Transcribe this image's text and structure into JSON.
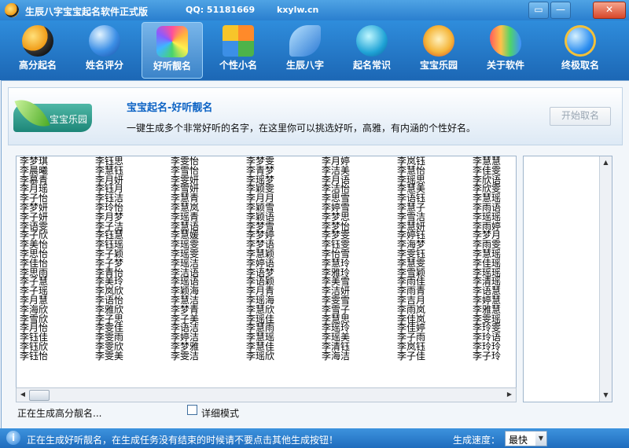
{
  "window": {
    "title": "生辰八字宝宝起名软件正式版",
    "qq": "QQ: 51181669",
    "site": "kxylw.cn",
    "buttons": {
      "menu": "▭",
      "min": "—",
      "close": "✕"
    }
  },
  "toolbar": {
    "items": [
      {
        "label": "高分起名",
        "icon": "yin-yang-icon"
      },
      {
        "label": "姓名评分",
        "icon": "globe-icon"
      },
      {
        "label": "好听靓名",
        "icon": "hexagon-cluster-icon"
      },
      {
        "label": "个性小名",
        "icon": "windows-logo-icon"
      },
      {
        "label": "生辰八字",
        "icon": "bird-icon"
      },
      {
        "label": "起名常识",
        "icon": "internet-icon"
      },
      {
        "label": "宝宝乐园",
        "icon": "mascot-icon"
      },
      {
        "label": "关于软件",
        "icon": "butterfly-icon"
      },
      {
        "label": "终极取名",
        "icon": "ie-globe-icon"
      }
    ],
    "active_index": 2
  },
  "banner": {
    "badge": "宝宝乐园",
    "title": "宝宝起名-好听靓名",
    "description": "一键生成多个非常好听的名字，在这里你可以挑选好听，高雅，有内涵的个性好名。",
    "start_button": "开始取名"
  },
  "names": {
    "columns": [
      [
        "李梦琪",
        "李晨曦",
        "李慕青",
        "李月瑶",
        "李子怡",
        "李梦妍",
        "李子妍",
        "李语雯",
        "李子欣",
        "李美怡",
        "李思怡",
        "李佳怡",
        "李思雨",
        "李子慧",
        "李子瑶",
        "李月慧",
        "李海欣",
        "李雪欣",
        "李月怡",
        "李钰佳",
        "李钰欣",
        "李钰怡"
      ],
      [
        "李钰思",
        "李慧钰",
        "李月妍",
        "李钰月",
        "李钰洁",
        "李玲怡",
        "李月梦",
        "李子洁",
        "李钰慧",
        "李钰瑶",
        "李子颖",
        "李子梦",
        "李青怡",
        "李美玲",
        "李岚欣",
        "李语怡",
        "李雅欣",
        "李子思",
        "李雯佳",
        "李雯雨",
        "李雯欣",
        "李雯美"
      ],
      [
        "李雯怡",
        "李雪怡",
        "李雯妍",
        "李雪妍",
        "李慧青",
        "李慧岚",
        "李瑶青",
        "李慧语",
        "李慧媛",
        "李瑶雯",
        "李瑶雯",
        "李瑶洁",
        "李洁语",
        "李瑶语",
        "李颖海",
        "李慧洁",
        "李梦青",
        "李子美",
        "李语洁",
        "李婷洁",
        "李梦雅",
        "李雯洁"
      ],
      [
        "李梦雯",
        "李青梦",
        "李瑶梦",
        "李颖雯",
        "李月月",
        "李颖雪",
        "李颖语",
        "李梦雪",
        "李梦婷",
        "李梦语",
        "李慧颖",
        "李婷语",
        "李语梦",
        "李语颖",
        "李月青",
        "李瑶海",
        "李慧欣",
        "李瑶佳",
        "李慧雨",
        "李慧瑶",
        "李慧佳",
        "李瑶欣"
      ],
      [
        "李月婷",
        "李洁美",
        "李月语",
        "李洁怡",
        "李思雪",
        "李婷雪",
        "李梦思",
        "李梦怡",
        "李梦雯",
        "李钰雯",
        "李怡雪",
        "李慧玲",
        "李雅玲",
        "李美雪",
        "李洁妍",
        "李雯雪",
        "李雪子",
        "李慧思",
        "李瑶玲",
        "李瑶美",
        "李清钰",
        "李海洁"
      ],
      [
        "李岚钰",
        "李慧怡",
        "李瑶思",
        "李慧美",
        "李语钰",
        "李慧子",
        "李雪洁",
        "李慧妍",
        "李婷钰",
        "李海梦",
        "李雯钰",
        "李慧雯",
        "李雪颖",
        "李雨佳",
        "李雨青",
        "李吉月",
        "李雨岚",
        "李佳岚",
        "李佳婷",
        "李子雨",
        "李岚钰",
        "李子佳"
      ],
      [
        "李慧慧",
        "李佳雯",
        "李欣语",
        "李欣雯",
        "李慧瑶",
        "李雨语",
        "李瑶瑶",
        "李雨婷",
        "李梦月",
        "李雨雯",
        "李慧瑶",
        "李佳瑶",
        "李瑶瑶",
        "李清瑶",
        "李语慧",
        "李婷慧",
        "李雅慧",
        "李雯瑶",
        "李玲雯",
        "李玲语",
        "李玲玲",
        "李子玲"
      ]
    ]
  },
  "bottom": {
    "generating": "正在生成高分靓名...",
    "detail_mode": "详细模式"
  },
  "statusbar": {
    "message": "正在生成好听靓名，在生成任务没有结束的时候请不要点击其他生成按钮！",
    "speed_label": "生成速度：",
    "speed_value": "最快"
  },
  "colors": {
    "accent": "#1c67b5",
    "title_blue": "#0b62c4",
    "toolbar_top": "#2f8ddc"
  }
}
